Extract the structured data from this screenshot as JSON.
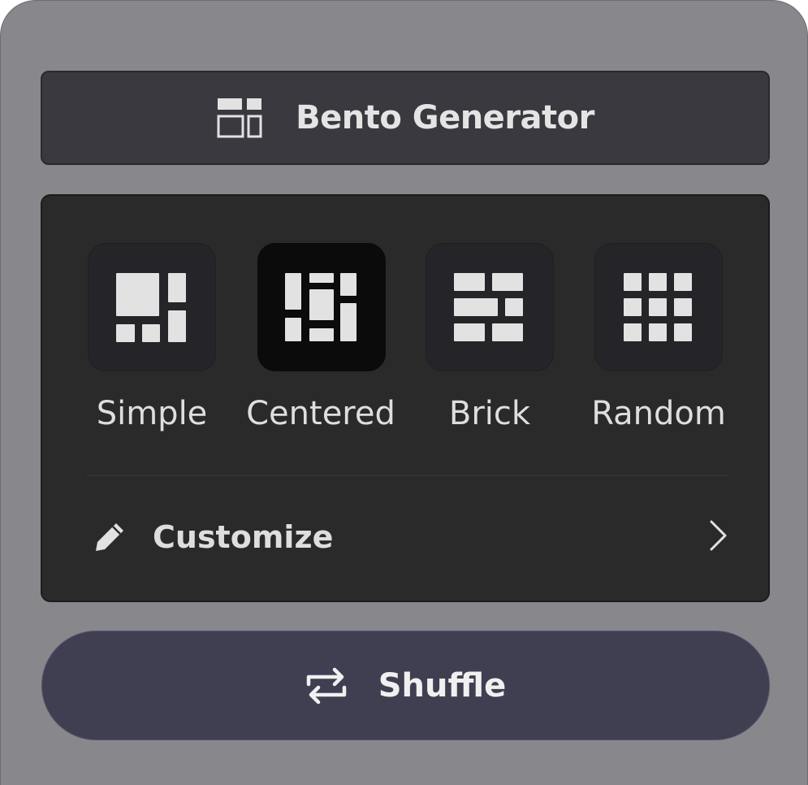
{
  "header": {
    "title": "Bento Generator",
    "icon": "bento-layout-icon"
  },
  "layouts": {
    "selected": "Centered",
    "items": [
      {
        "label": "Simple",
        "icon": "simple-layout-icon"
      },
      {
        "label": "Centered",
        "icon": "centered-layout-icon"
      },
      {
        "label": "Brick",
        "icon": "brick-layout-icon"
      },
      {
        "label": "Random",
        "icon": "random-layout-icon"
      }
    ]
  },
  "customize": {
    "label": "Customize",
    "icon": "pencil-icon",
    "chevron": "chevron-right-icon"
  },
  "shuffle": {
    "label": "Shuffle",
    "icon": "shuffle-icon"
  },
  "colors": {
    "panel": "#88878c",
    "header": "#3a393f",
    "card": "#2a2a2a",
    "selected_tile": "#0b0b0b",
    "button": "#403f52",
    "text": "#e4e4e4"
  }
}
